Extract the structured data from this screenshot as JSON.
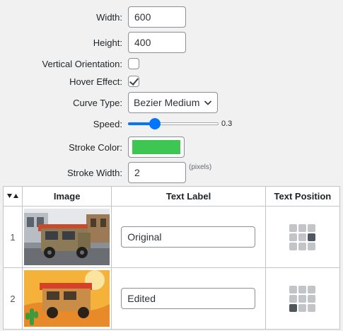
{
  "form": {
    "width": {
      "label": "Width:",
      "value": "600"
    },
    "height": {
      "label": "Height:",
      "value": "400"
    },
    "vertical": {
      "label": "Vertical Orientation:",
      "checked": false
    },
    "hover": {
      "label": "Hover Effect:",
      "checked": true
    },
    "curve": {
      "label": "Curve Type:",
      "value": "Bezier Medium"
    },
    "speed": {
      "label": "Speed:",
      "value": "0.3",
      "fraction": 0.3
    },
    "stroke_color": {
      "label": "Stroke Color:",
      "color": "#3ec552"
    },
    "stroke_width": {
      "label": "Stroke Width:",
      "value": "2",
      "hint": "(pixels)"
    }
  },
  "table": {
    "headers": {
      "image": "Image",
      "text_label": "Text Label",
      "text_position": "Text Position"
    },
    "rows": [
      {
        "num": "1",
        "label": "Original",
        "position_active": 5
      },
      {
        "num": "2",
        "label": "Edited",
        "position_active": 6
      }
    ]
  },
  "colors": {
    "accent": "#0075ff",
    "border": "#8c8f94",
    "background": "#f1f1f1"
  }
}
